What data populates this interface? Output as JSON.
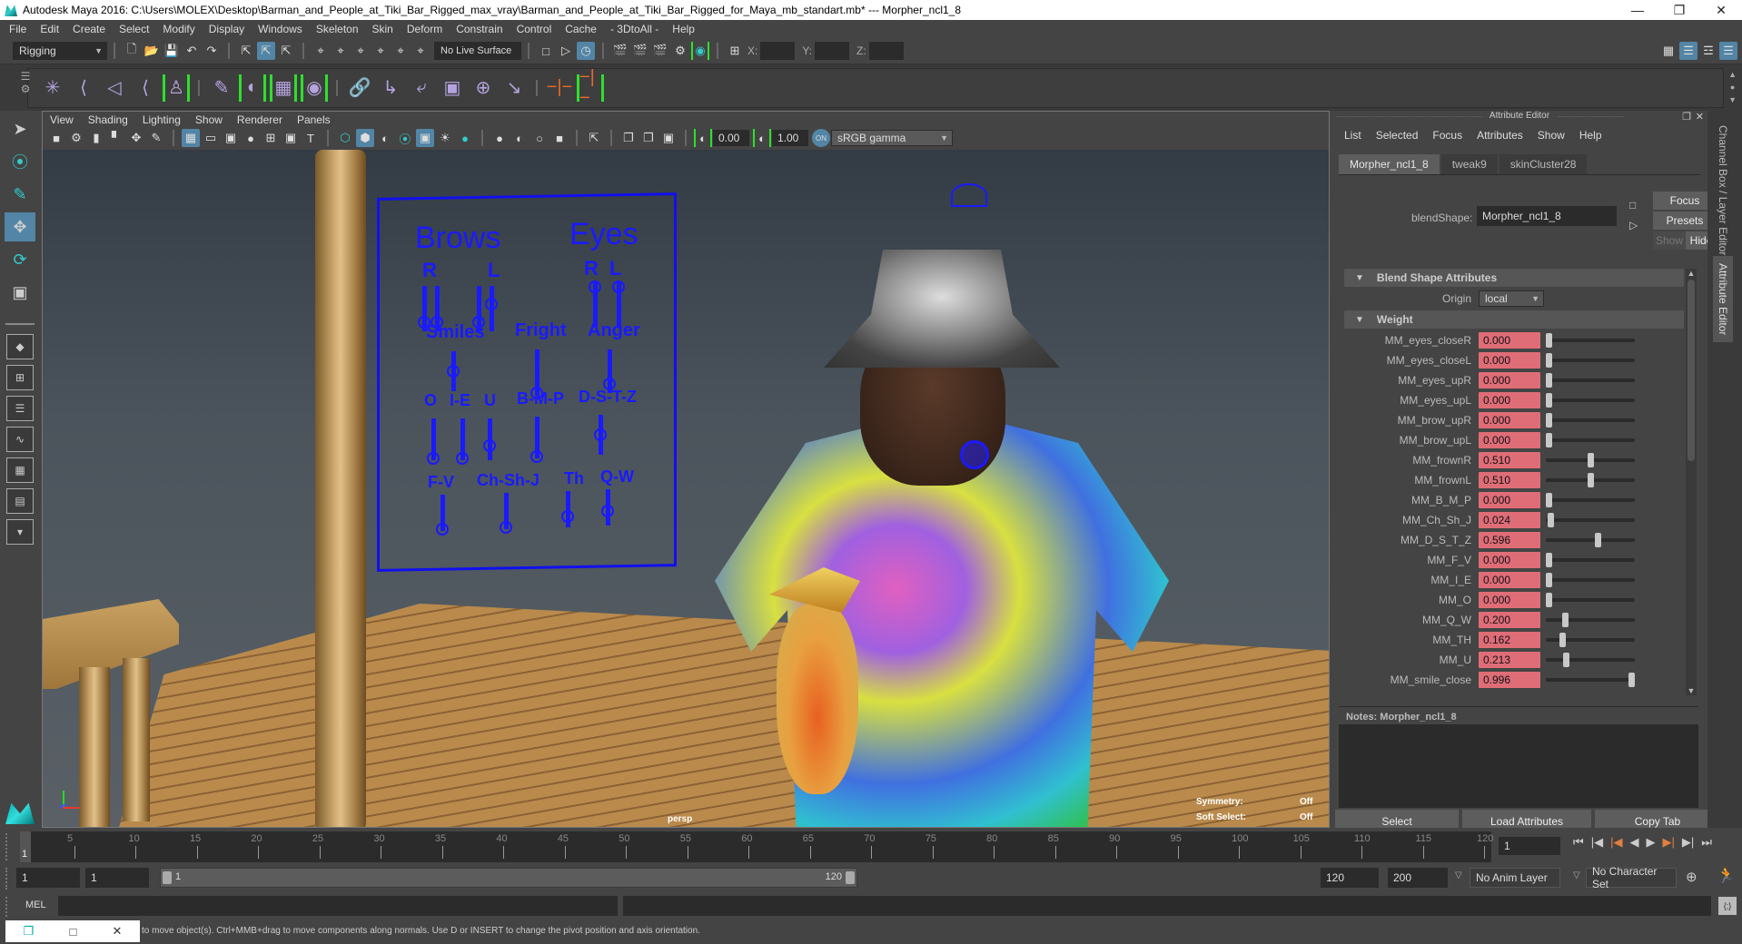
{
  "window": {
    "title": "Autodesk Maya 2016: C:\\Users\\MOLEX\\Desktop\\Barman_and_People_at_Tiki_Bar_Rigged_max_vray\\Barman_and_People_at_Tiki_Bar_Rigged_for_Maya_mb_standart.mb*  ---  Morpher_ncl1_8",
    "controls": [
      "minimize-icon",
      "restore-icon",
      "close-icon"
    ]
  },
  "menubar": [
    "File",
    "Edit",
    "Create",
    "Select",
    "Modify",
    "Display",
    "Windows",
    "Skeleton",
    "Skin",
    "Deform",
    "Constrain",
    "Control",
    "Cache",
    "- 3DtoAll -",
    "Help"
  ],
  "statusline": {
    "menuset": "Rigging",
    "live_surface": "No Live Surface",
    "x_label": "X:",
    "y_label": "Y:",
    "z_label": "Z:",
    "x": "",
    "y": "",
    "z": ""
  },
  "shelf": {
    "icons": [
      "joint-tool-icon",
      "insert-joint-icon",
      "mirror-joint-icon",
      "ik-handle-icon",
      "quick-rig-icon",
      "paint-weights-icon",
      "blend-shape-icon",
      "lattice-icon",
      "wrap-icon",
      "parent-constraint-icon",
      "point-constraint-icon",
      "orient-constraint-icon",
      "scale-constraint-icon",
      "aim-constraint-icon",
      "pole-vector-icon",
      "hik-icon",
      "hik-skeleton-icon"
    ]
  },
  "toolbox": {
    "tools": [
      "select-tool-icon",
      "lasso-tool-icon",
      "paint-select-icon",
      "move-tool-icon",
      "rotate-tool-icon",
      "scale-tool-icon"
    ],
    "active_tool": "move-tool-icon",
    "layouts": [
      "single-pane-layout",
      "four-pane-layout",
      "outliner-persp-layout",
      "graph-editor-layout",
      "hypershade-layout",
      "node-editor-layout",
      "more-layouts"
    ]
  },
  "viewport": {
    "menu": [
      "View",
      "Shading",
      "Lighting",
      "Show",
      "Renderer",
      "Panels"
    ],
    "exposure": "0.00",
    "gamma": "1.00",
    "color_space": "sRGB gamma",
    "camera": "persp",
    "hud": [
      {
        "label": "Symmetry:",
        "value": "Off"
      },
      {
        "label": "Soft Select:",
        "value": "Off"
      }
    ],
    "face_panel": {
      "headers": [
        "Brows",
        "Eyes"
      ],
      "brows_sides": [
        "R",
        "L"
      ],
      "eyes_sides": [
        "R",
        "L"
      ],
      "row2": [
        "Smiles",
        "Fright",
        "Anger"
      ],
      "row3": [
        "O",
        "I-E",
        "U",
        "B-M-P",
        "D-S-T-Z"
      ],
      "row4": [
        "F-V",
        "Ch-Sh-J",
        "Th",
        "Q-W"
      ]
    }
  },
  "attribute_editor": {
    "title": "Attribute Editor",
    "menu": [
      "List",
      "Selected",
      "Focus",
      "Attributes",
      "Show",
      "Help"
    ],
    "tabs": [
      "Morpher_ncl1_8",
      "tweak9",
      "skinCluster28"
    ],
    "active_tab": "Morpher_ncl1_8",
    "node_type_label": "blendShape:",
    "node_name": "Morpher_ncl1_8",
    "buttons": {
      "focus": "Focus",
      "presets": "Presets",
      "show": "Show",
      "hide": "Hide"
    },
    "section_blend": "Blend Shape Attributes",
    "origin_label": "Origin",
    "origin_value": "local",
    "section_weight": "Weight",
    "weights": [
      {
        "name": "MM_eyes_closeR",
        "value": "0.000",
        "fraction": 0.0
      },
      {
        "name": "MM_eyes_closeL",
        "value": "0.000",
        "fraction": 0.0
      },
      {
        "name": "MM_eyes_upR",
        "value": "0.000",
        "fraction": 0.0
      },
      {
        "name": "MM_eyes_upL",
        "value": "0.000",
        "fraction": 0.0
      },
      {
        "name": "MM_brow_upR",
        "value": "0.000",
        "fraction": 0.0
      },
      {
        "name": "MM_brow_upL",
        "value": "0.000",
        "fraction": 0.0
      },
      {
        "name": "MM_frownR",
        "value": "0.510",
        "fraction": 0.51
      },
      {
        "name": "MM_frownL",
        "value": "0.510",
        "fraction": 0.51
      },
      {
        "name": "MM_B_M_P",
        "value": "0.000",
        "fraction": 0.0
      },
      {
        "name": "MM_Ch_Sh_J",
        "value": "0.024",
        "fraction": 0.024
      },
      {
        "name": "MM_D_S_T_Z",
        "value": "0.596",
        "fraction": 0.596
      },
      {
        "name": "MM_F_V",
        "value": "0.000",
        "fraction": 0.0
      },
      {
        "name": "MM_I_E",
        "value": "0.000",
        "fraction": 0.0
      },
      {
        "name": "MM_O",
        "value": "0.000",
        "fraction": 0.0
      },
      {
        "name": "MM_Q_W",
        "value": "0.200",
        "fraction": 0.2
      },
      {
        "name": "MM_TH",
        "value": "0.162",
        "fraction": 0.162
      },
      {
        "name": "MM_U",
        "value": "0.213",
        "fraction": 0.213
      },
      {
        "name": "MM_smile_close",
        "value": "0.996",
        "fraction": 0.996
      }
    ],
    "notes_label": "Notes:  Morpher_ncl1_8",
    "notes_text": "",
    "bottom_buttons": [
      "Select",
      "Load Attributes",
      "Copy Tab"
    ]
  },
  "side_tabs": [
    "Channel Box / Layer Editor",
    "Attribute Editor"
  ],
  "timeline": {
    "ticks": [
      5,
      10,
      15,
      20,
      25,
      30,
      35,
      40,
      45,
      50,
      55,
      60,
      65,
      70,
      75,
      80,
      85,
      90,
      95,
      100,
      105,
      110,
      115,
      120
    ],
    "start": 1,
    "end": 120,
    "current_frame": "1",
    "current_marker": "1"
  },
  "range": {
    "start_field": "1",
    "playback_start": "1",
    "slider_start": "1",
    "slider_end": "120",
    "playback_end": "120",
    "end_field": "200",
    "anim_layer": "No Anim Layer",
    "character_set": "No Character Set"
  },
  "command_line": {
    "mode": "MEL",
    "input": "",
    "output": ""
  },
  "help_line": "to move object(s). Ctrl+MMB+drag to move components along normals. Use D or INSERT to change the pivot position and axis orientation."
}
